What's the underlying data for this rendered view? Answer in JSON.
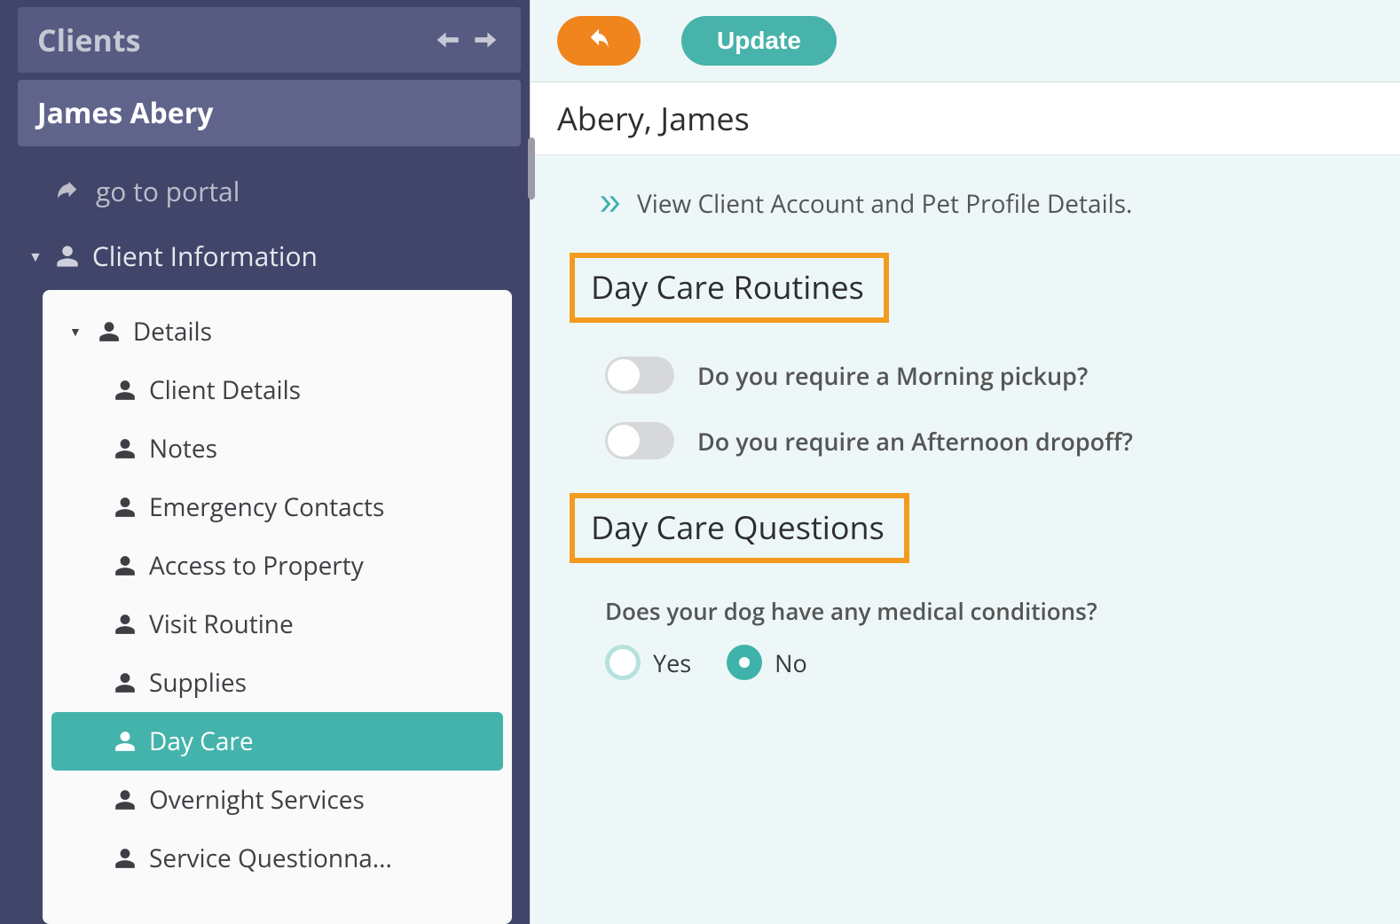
{
  "sidebar": {
    "panel_title": "Clients",
    "client_name": "James Abery",
    "portal_link": "go to portal",
    "section_title": "Client Information",
    "details_label": "Details",
    "items": [
      {
        "label": "Client Details",
        "active": false
      },
      {
        "label": "Notes",
        "active": false
      },
      {
        "label": "Emergency Contacts",
        "active": false
      },
      {
        "label": "Access to Property",
        "active": false
      },
      {
        "label": "Visit Routine",
        "active": false
      },
      {
        "label": "Supplies",
        "active": false
      },
      {
        "label": "Day Care",
        "active": true
      },
      {
        "label": "Overnight Services",
        "active": false
      },
      {
        "label": "Service Questionna...",
        "active": false
      }
    ]
  },
  "toolbar": {
    "update_label": "Update"
  },
  "main": {
    "client_heading": "Abery, James",
    "view_link": "View Client Account and Pet Profile Details.",
    "sections": {
      "routines": {
        "title": "Day Care Routines",
        "toggles": [
          {
            "label": "Do you require a Morning pickup?",
            "on": false
          },
          {
            "label": "Do you require an Afternoon dropoff?",
            "on": false
          }
        ]
      },
      "questions": {
        "title": "Day Care Questions",
        "q1": {
          "text": "Does your dog have any medical conditions?",
          "options": {
            "yes": "Yes",
            "no": "No"
          },
          "selected": "no"
        }
      }
    }
  },
  "colors": {
    "sidebar_bg": "#41456a",
    "accent_teal": "#44b3ab",
    "accent_orange": "#f0841d",
    "highlight_border": "#f29b1e"
  }
}
